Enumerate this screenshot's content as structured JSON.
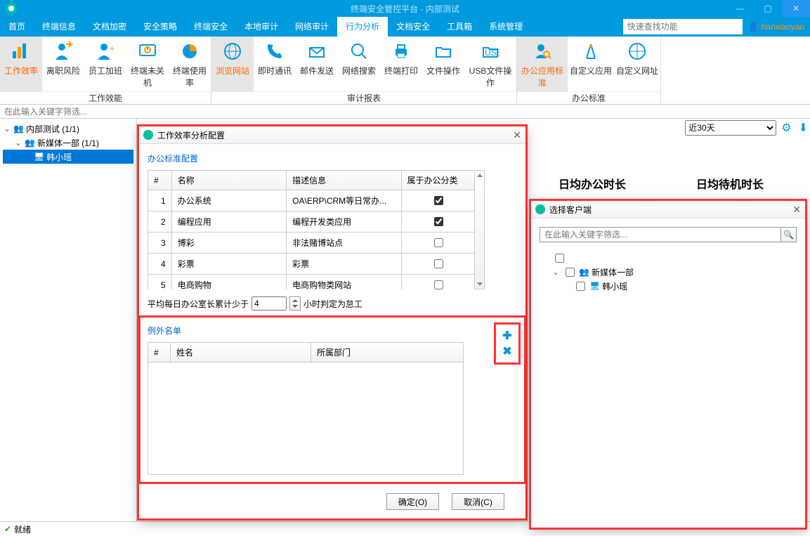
{
  "app_title": "终端安全管控平台 - 内部测试",
  "user_name": "hanxiaoyao",
  "quick_search_placeholder": "快速查找功能",
  "menu": [
    "首页",
    "终端信息",
    "文档加密",
    "安全策略",
    "终端安全",
    "本地审计",
    "网络审计",
    "行为分析",
    "文档安全",
    "工具箱",
    "系统管理"
  ],
  "menu_active_index": 7,
  "ribbon_groups": [
    {
      "label": "工作效能",
      "items": [
        "工作效率",
        "离职风险",
        "员工加班",
        "终端未关机",
        "终端使用率"
      ]
    },
    {
      "label": "审计报表",
      "items": [
        "浏览网站",
        "即时通讯",
        "邮件发送",
        "网络搜索",
        "终端打印",
        "文件操作",
        "USB文件操作"
      ]
    },
    {
      "label": "办公标准",
      "items": [
        "办公应用标准",
        "自定义应用",
        "自定义网址"
      ]
    }
  ],
  "filter_placeholder": "在此输入关键字筛选...",
  "tree": {
    "root": "内部测试 (1/1)",
    "child": "新媒体一部 (1/1)",
    "leaf": "韩小瑶"
  },
  "time_range_selected": "近30天",
  "stats": [
    {
      "title": "日均办公时长"
    },
    {
      "title": "日均待机时长"
    }
  ],
  "status_text": "就绪",
  "dialog1": {
    "title": "工作效率分析配置",
    "section1_title": "办公标准配置",
    "table_headers": [
      "#",
      "名称",
      "描述信息",
      "属于办公分类"
    ],
    "rows": [
      {
        "num": "1",
        "name": "办公系统",
        "desc": "OA\\ERP\\CRM等日常办...",
        "checked": true
      },
      {
        "num": "2",
        "name": "编程应用",
        "desc": "编程开发类应用",
        "checked": true
      },
      {
        "num": "3",
        "name": "博彩",
        "desc": "非法赌博站点",
        "checked": false
      },
      {
        "num": "4",
        "name": "彩票",
        "desc": "彩票",
        "checked": false
      },
      {
        "num": "5",
        "name": "电商购物",
        "desc": "电商购物类网站",
        "checked": false
      }
    ],
    "avg_prefix": "平均每日办公室长累计少于",
    "avg_value": "4",
    "avg_suffix": "小时判定为怠工",
    "section2_title": "例外名单",
    "exc_headers": [
      "#",
      "姓名",
      "所属部门"
    ],
    "ok_label": "确定(O)",
    "cancel_label": "取消(C)"
  },
  "dialog2": {
    "title": "选择客户端",
    "search_placeholder": "在此输入关键字筛选...",
    "group": "新媒体一部",
    "leaf": "韩小瑶"
  }
}
